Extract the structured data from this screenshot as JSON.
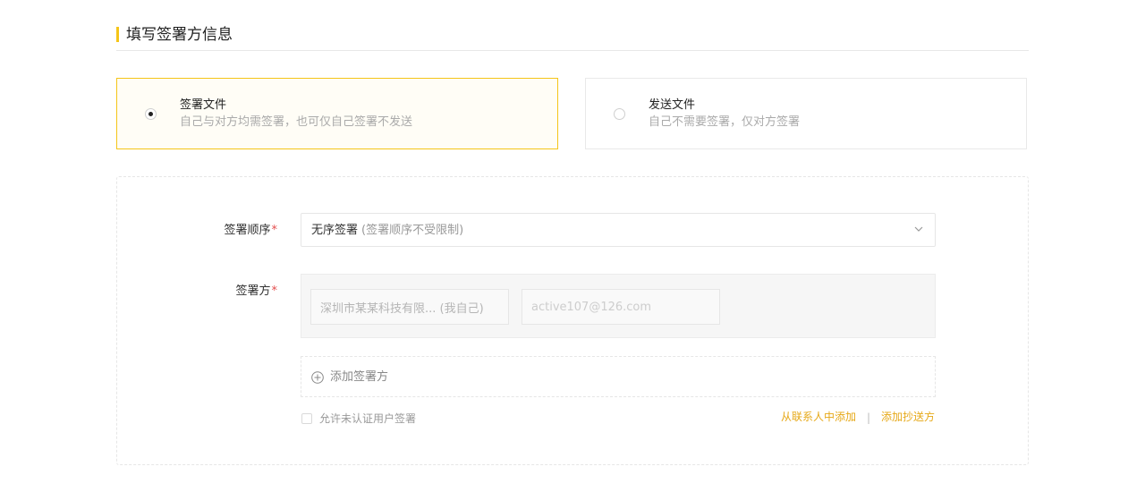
{
  "section": {
    "title": "填写签署方信息"
  },
  "modes": [
    {
      "title": "签署文件",
      "description": "自己与对方均需签署，也可仅自己签署不发送",
      "selected": true
    },
    {
      "title": "发送文件",
      "description": "自己不需要签署，仅对方签署",
      "selected": false
    }
  ],
  "form": {
    "order": {
      "label": "签署顺序",
      "required_mark": "*",
      "selected_value": "无序签署",
      "selected_hint": "(签署顺序不受限制)"
    },
    "signer": {
      "label": "签署方",
      "required_mark": "*",
      "company": "深圳市某某科技有限... (我自己)",
      "email": "active107@126.com"
    },
    "add_signer_label": "添加签署方",
    "allow_unverified_label": "允许未认证用户签署",
    "link_from_contacts": "从联系人中添加",
    "link_separator": "|",
    "link_add_cc": "添加抄送方"
  },
  "colors": {
    "accent": "#f5c518",
    "link": "#e6a817",
    "required": "#e34d4d"
  }
}
